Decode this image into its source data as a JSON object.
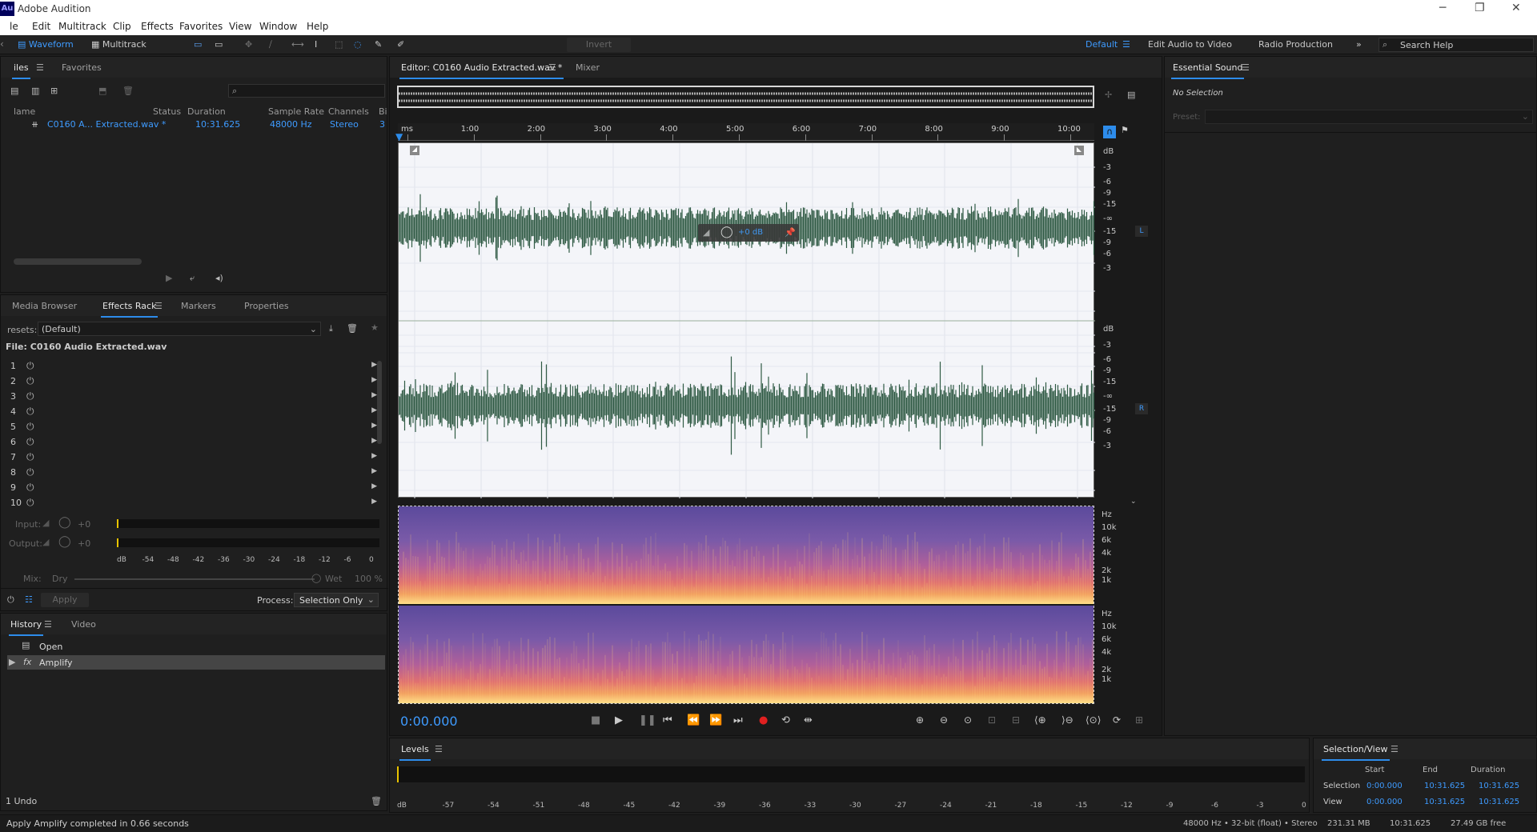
{
  "app": {
    "title": "Adobe Audition",
    "logo": "Au"
  },
  "menu": [
    "le",
    "Edit",
    "Multitrack",
    "Clip",
    "Effects",
    "Favorites",
    "View",
    "Window",
    "Help"
  ],
  "toolbar": {
    "waveform": "Waveform",
    "multitrack": "Multitrack",
    "invert": "Invert",
    "workspaces": [
      "Default",
      "Edit Audio to Video",
      "Radio Production"
    ],
    "search_placeholder": "Search Help"
  },
  "files": {
    "tabs": [
      "iles",
      "Favorites"
    ],
    "columns": [
      "lame",
      "Status",
      "Duration",
      "Sample Rate",
      "Channels",
      "Bi"
    ],
    "row": {
      "name": "C0160 A... Extracted.wav *",
      "duration": "10:31.625",
      "rate": "48000 Hz",
      "channels": "Stereo",
      "bits": "3"
    }
  },
  "effects": {
    "tabs": [
      "Media Browser",
      "Effects Rack",
      "Markers",
      "Properties"
    ],
    "presets_label": "resets:",
    "preset": "(Default)",
    "file_label": "File: C0160 Audio Extracted.wav",
    "slots": [
      "1",
      "2",
      "3",
      "4",
      "5",
      "6",
      "7",
      "8",
      "9",
      "10"
    ],
    "input_label": "Input:",
    "output_label": "Output:",
    "gain": "+0",
    "meter_ticks": [
      "dB",
      "-54",
      "-48",
      "-42",
      "-36",
      "-30",
      "-24",
      "-18",
      "-12",
      "-6",
      "0"
    ],
    "mix_label": "Mix:",
    "dry": "Dry",
    "wet": "Wet",
    "wet_pct": "100 %",
    "apply": "Apply",
    "process_label": "Process:",
    "process_value": "Selection Only"
  },
  "history": {
    "tabs": [
      "History",
      "Video"
    ],
    "items": [
      "Open",
      "Amplify"
    ],
    "undo": "1 Undo"
  },
  "status": {
    "message": "Apply Amplify completed in 0.66 seconds",
    "format": "48000 Hz • 32-bit (float) • Stereo",
    "size": "231.31 MB",
    "duration": "10:31.625",
    "free": "27.49 GB free"
  },
  "editor": {
    "tab": "Editor: C0160 Audio Extracted.wav *",
    "mixer": "Mixer",
    "ruler": [
      "ms",
      "1:00",
      "2:00",
      "3:00",
      "4:00",
      "5:00",
      "6:00",
      "7:00",
      "8:00",
      "9:00",
      "10:00"
    ],
    "db_scale": [
      "dB",
      "-3",
      "-6",
      "-9",
      "-15",
      "-∞",
      "-15",
      "-9",
      "-6",
      "-3"
    ],
    "hud": "+0 dB",
    "channel_left": "L",
    "channel_right": "R",
    "hz_scale": [
      "Hz",
      "10k",
      "6k",
      "4k",
      "2k",
      "1k"
    ],
    "time": "0:00.000"
  },
  "essential": {
    "title": "Essential Sound",
    "no_selection": "No Selection",
    "preset_label": "Preset:"
  },
  "levels": {
    "title": "Levels",
    "ticks": [
      "dB",
      "-57",
      "-54",
      "-51",
      "-48",
      "-45",
      "-42",
      "-39",
      "-36",
      "-33",
      "-30",
      "-27",
      "-24",
      "-21",
      "-18",
      "-15",
      "-12",
      "-9",
      "-6",
      "-3",
      "0"
    ]
  },
  "selection": {
    "title": "Selection/View",
    "headers": [
      "Start",
      "End",
      "Duration"
    ],
    "rows": [
      {
        "label": "Selection",
        "start": "0:00.000",
        "end": "10:31.625",
        "duration": "10:31.625"
      },
      {
        "label": "View",
        "start": "0:00.000",
        "end": "10:31.625",
        "duration": "10:31.625"
      }
    ]
  }
}
